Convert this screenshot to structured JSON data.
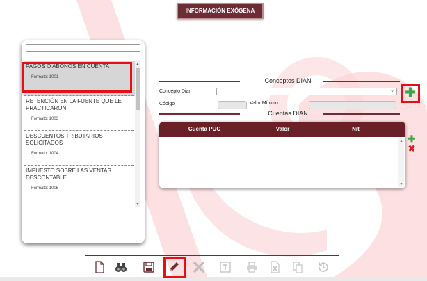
{
  "header": {
    "button_label": "INFORMACIÓN EXÓGENA"
  },
  "left_panel": {
    "search_value": "",
    "items": [
      {
        "title": "PAGOS O ABONOS EN CUENTA",
        "format": "Formato: 1001"
      },
      {
        "title": "RETENCIÓN EN LA FUENTE QUE LE PRACTICARON",
        "format": "Formato: 1003"
      },
      {
        "title": "DESCUENTOS TRIBUTARIOS SOLICITADOS",
        "format": "Formato: 1004"
      },
      {
        "title": "IMPUESTO SOBRE LAS VENTAS DESCONTABLE",
        "format": "Formato: 1005"
      }
    ]
  },
  "conceptos": {
    "section_title": "Conceptos DIAN",
    "concepto_label": "Concepto Dian",
    "concepto_value": "",
    "codigo_label": "Código",
    "valor_minimo_label": "Valor Mínimo"
  },
  "cuentas": {
    "section_title": "Cuentas DIAN",
    "columns": [
      "Cuenta PUC",
      "Valor",
      "Nit"
    ]
  },
  "icons": {
    "add": "plus-icon",
    "remove": "x-icon",
    "toolbar": [
      "new-document-icon",
      "binoculars-icon",
      "save-icon",
      "edit-icon",
      "delete-icon",
      "text-icon",
      "print-icon",
      "excel-icon",
      "copy-icon",
      "history-icon"
    ]
  },
  "colors": {
    "primary": "#6e2d35",
    "table_header": "#6b2028",
    "highlight": "#e3101a",
    "add": "#3aa845",
    "remove": "#d32027"
  }
}
